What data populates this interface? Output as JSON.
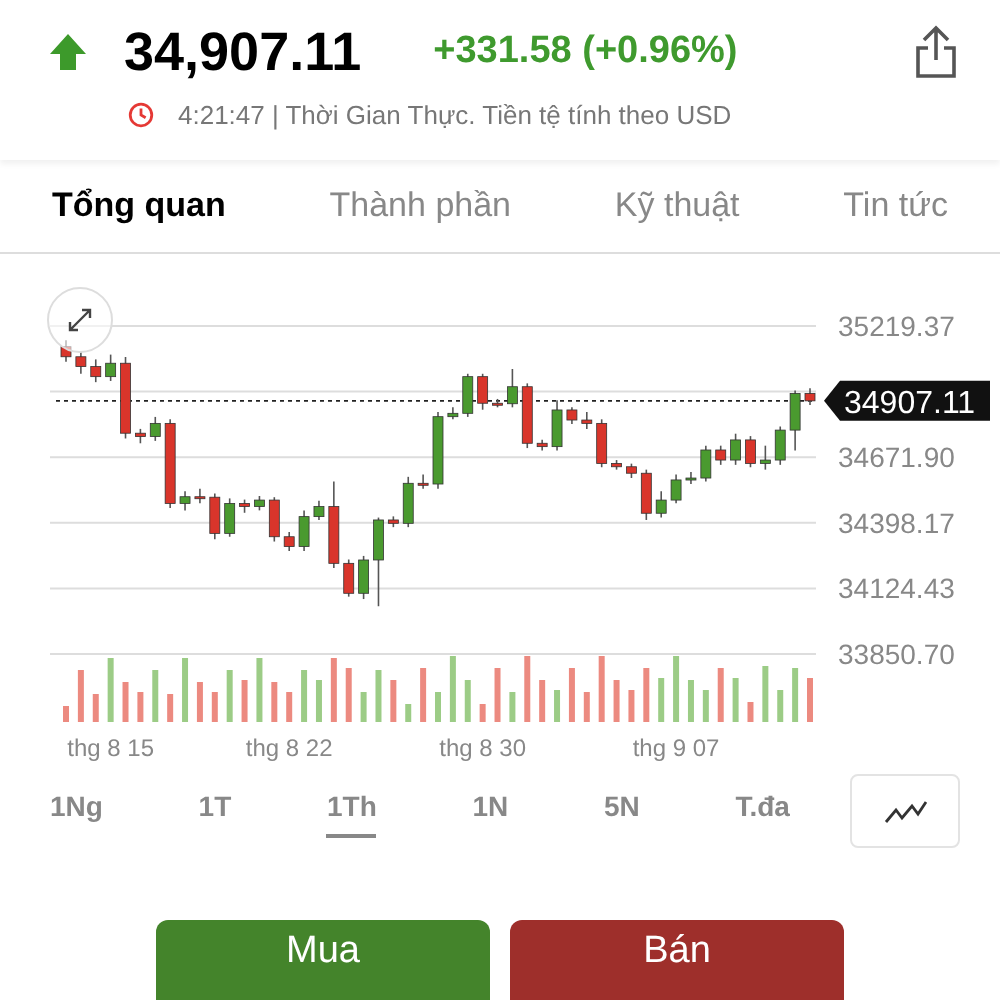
{
  "header": {
    "rising": true,
    "price": "34,907.11",
    "change": "+331.58 (+0.96%)",
    "timestamp": "4:21:47 | Thời Gian Thực. Tiền tệ tính theo USD"
  },
  "tabs": [
    {
      "label": "Tổng quan",
      "selected": true
    },
    {
      "label": "Thành phần",
      "selected": false
    },
    {
      "label": "Kỹ thuật",
      "selected": false
    },
    {
      "label": "Tin tức",
      "selected": false
    }
  ],
  "chart": {
    "chart_data": {
      "type": "candlestick",
      "grid": true,
      "ref_lines": [
        {
          "axis": "y",
          "value": 34907.11,
          "label": "34907.11"
        }
      ],
      "categories": [
        null,
        null,
        null,
        "thg 8 15",
        null,
        null,
        null,
        null,
        null,
        null,
        null,
        null,
        null,
        null,
        null,
        "thg 8 22",
        null,
        null,
        null,
        null,
        null,
        null,
        null,
        null,
        null,
        null,
        null,
        null,
        "thg 8 30",
        null,
        null,
        null,
        null,
        null,
        null,
        null,
        null,
        null,
        null,
        null,
        null,
        "thg 9 07",
        null,
        null,
        null,
        null,
        null,
        null,
        null,
        null,
        null
      ],
      "ohlc": [
        [
          35133,
          35160,
          35070,
          35091
        ],
        [
          35091,
          35115,
          35020,
          35050
        ],
        [
          35050,
          35080,
          34985,
          35008
        ],
        [
          35008,
          35100,
          34990,
          35064
        ],
        [
          35064,
          35090,
          34750,
          34772
        ],
        [
          34772,
          34790,
          34730,
          34758
        ],
        [
          34758,
          34840,
          34740,
          34813
        ],
        [
          34813,
          34830,
          34460,
          34479
        ],
        [
          34479,
          34530,
          34450,
          34507
        ],
        [
          34507,
          34540,
          34480,
          34505
        ],
        [
          34505,
          34520,
          34330,
          34354
        ],
        [
          34354,
          34500,
          34340,
          34479
        ],
        [
          34479,
          34495,
          34440,
          34466
        ],
        [
          34466,
          34510,
          34450,
          34493
        ],
        [
          34493,
          34505,
          34320,
          34340
        ],
        [
          34340,
          34360,
          34280,
          34299
        ],
        [
          34299,
          34450,
          34280,
          34424
        ],
        [
          34424,
          34490,
          34410,
          34466
        ],
        [
          34466,
          34570,
          34210,
          34229
        ],
        [
          34229,
          34245,
          34090,
          34104
        ],
        [
          34104,
          34260,
          34080,
          34243
        ],
        [
          34243,
          34420,
          34050,
          34410
        ],
        [
          34410,
          34425,
          34380,
          34396
        ],
        [
          34396,
          34590,
          34380,
          34563
        ],
        [
          34563,
          34600,
          34540,
          34560
        ],
        [
          34560,
          34860,
          34540,
          34841
        ],
        [
          34841,
          34880,
          34830,
          34855
        ],
        [
          34855,
          35020,
          34840,
          35008
        ],
        [
          35008,
          35020,
          34870,
          34897
        ],
        [
          34897,
          34915,
          34880,
          34895
        ],
        [
          34895,
          35040,
          34880,
          34966
        ],
        [
          34966,
          34980,
          34710,
          34730
        ],
        [
          34730,
          34745,
          34700,
          34716
        ],
        [
          34716,
          34910,
          34700,
          34869
        ],
        [
          34869,
          34880,
          34810,
          34827
        ],
        [
          34827,
          34860,
          34790,
          34813
        ],
        [
          34813,
          34830,
          34630,
          34646
        ],
        [
          34646,
          34660,
          34620,
          34632
        ],
        [
          34632,
          34645,
          34585,
          34605
        ],
        [
          34605,
          34620,
          34410,
          34438
        ],
        [
          34438,
          34530,
          34420,
          34493
        ],
        [
          34493,
          34600,
          34480,
          34577
        ],
        [
          34577,
          34610,
          34560,
          34585
        ],
        [
          34585,
          34720,
          34570,
          34702
        ],
        [
          34702,
          34720,
          34640,
          34660
        ],
        [
          34660,
          34770,
          34640,
          34744
        ],
        [
          34744,
          34760,
          34630,
          34646
        ],
        [
          34646,
          34720,
          34620,
          34660
        ],
        [
          34660,
          34800,
          34640,
          34785
        ],
        [
          34785,
          34950,
          34700,
          34938
        ],
        [
          34938,
          34960,
          34890,
          34907
        ]
      ],
      "ylim": [
        33850.7,
        35219.37
      ],
      "yticks": [
        {
          "value": 35219.37,
          "label": "35219.37"
        },
        {
          "value": 34671.9,
          "label": "34671.90"
        },
        {
          "value": 34398.17,
          "label": "34398.17"
        },
        {
          "value": 34124.43,
          "label": "34124.43"
        },
        {
          "value": 33850.7,
          "label": "33850.70"
        }
      ]
    }
  },
  "periods": [
    {
      "label": "1Ng",
      "selected": false
    },
    {
      "label": "1T",
      "selected": false
    },
    {
      "label": "1Th",
      "selected": true
    },
    {
      "label": "1N",
      "selected": false
    },
    {
      "label": "5N",
      "selected": false
    },
    {
      "label": "T.đa",
      "selected": false
    }
  ],
  "actions": [
    {
      "label": "Mua",
      "kind": "buy"
    },
    {
      "label": "Bán",
      "kind": "sell"
    }
  ]
}
